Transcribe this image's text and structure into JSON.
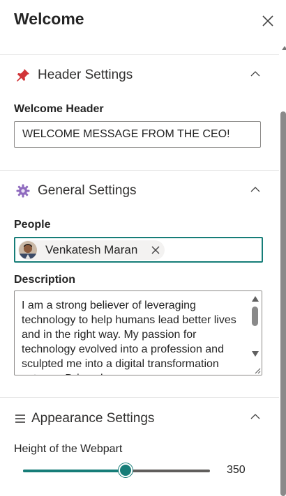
{
  "panel": {
    "title": "Welcome"
  },
  "sections": {
    "header": {
      "title": "Header Settings",
      "icon": "pushpin-icon"
    },
    "general": {
      "title": "General Settings",
      "icon": "gear-icon"
    },
    "appearance": {
      "title": "Appearance Settings",
      "icon": "hamburger-icon"
    }
  },
  "fields": {
    "welcome_header": {
      "label": "Welcome Header",
      "value": "WELCOME MESSAGE FROM THE CEO!"
    },
    "people": {
      "label": "People",
      "persona_name": "Venkatesh Maran"
    },
    "description": {
      "label": "Description",
      "value": "I am a strong believer of leveraging technology to help humans lead better lives and in the right way. My passion for technology evolved into a profession and sculpted me into a digital transformation veteran. Driven by"
    },
    "height": {
      "label": "Height of the Webpart",
      "value": "350",
      "fraction": 0.55
    }
  },
  "colors": {
    "accent": "#167d78",
    "pin": "#d13438",
    "gear": "#8f6bbf"
  }
}
